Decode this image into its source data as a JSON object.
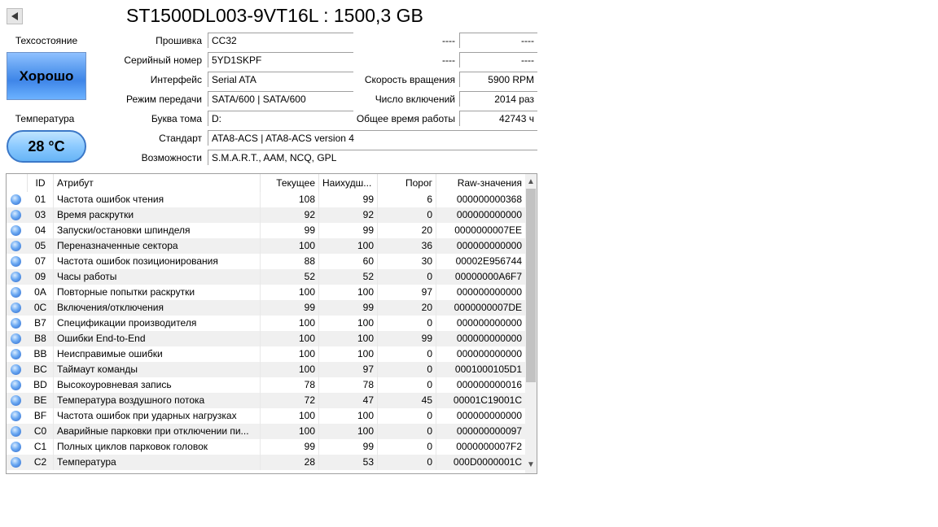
{
  "title": "ST1500DL003-9VT16L : 1500,3 GB",
  "status": {
    "health_label": "Техсостояние",
    "health_value": "Хорошо",
    "temp_label": "Температура",
    "temp_value": "28 °C",
    "health_color": "#4a8fe8"
  },
  "info": {
    "firmware_label": "Прошивка",
    "firmware": "CC32",
    "serial_label": "Серийный номер",
    "serial": "5YD1SKPF",
    "interface_label": "Интерфейс",
    "interface": "Serial ATA",
    "transfer_label": "Режим передачи",
    "transfer": "SATA/600 | SATA/600",
    "volume_label": "Буква тома",
    "volume": "D:",
    "standard_label": "Стандарт",
    "standard": "ATA8-ACS | ATA8-ACS version 4",
    "features_label": "Возможности",
    "features": "S.M.A.R.T., AAM, NCQ, GPL",
    "r1_label": "----",
    "r1_value": "----",
    "r2_label": "----",
    "r2_value": "----",
    "rpm_label": "Скорость вращения",
    "rpm": "5900 RPM",
    "power_count_label": "Число включений",
    "power_count": "2014 раз",
    "power_hours_label": "Общее время работы",
    "power_hours": "42743 ч"
  },
  "table": {
    "headers": [
      "ID",
      "Атрибут",
      "Текущее",
      "Наихудш...",
      "Порог",
      "Raw-значения"
    ],
    "rows": [
      {
        "id": "01",
        "name": "Частота ошибок чтения",
        "cur": "108",
        "worst": "99",
        "thr": "6",
        "raw": "000000000368"
      },
      {
        "id": "03",
        "name": "Время раскрутки",
        "cur": "92",
        "worst": "92",
        "thr": "0",
        "raw": "000000000000"
      },
      {
        "id": "04",
        "name": "Запуски/остановки шпинделя",
        "cur": "99",
        "worst": "99",
        "thr": "20",
        "raw": "0000000007EE"
      },
      {
        "id": "05",
        "name": "Переназначенные сектора",
        "cur": "100",
        "worst": "100",
        "thr": "36",
        "raw": "000000000000"
      },
      {
        "id": "07",
        "name": "Частота ошибок позиционирования",
        "cur": "88",
        "worst": "60",
        "thr": "30",
        "raw": "00002E956744"
      },
      {
        "id": "09",
        "name": "Часы работы",
        "cur": "52",
        "worst": "52",
        "thr": "0",
        "raw": "00000000A6F7"
      },
      {
        "id": "0A",
        "name": "Повторные попытки раскрутки",
        "cur": "100",
        "worst": "100",
        "thr": "97",
        "raw": "000000000000"
      },
      {
        "id": "0C",
        "name": "Включения/отключения",
        "cur": "99",
        "worst": "99",
        "thr": "20",
        "raw": "0000000007DE"
      },
      {
        "id": "B7",
        "name": "Спецификации производителя",
        "cur": "100",
        "worst": "100",
        "thr": "0",
        "raw": "000000000000"
      },
      {
        "id": "B8",
        "name": "Ошибки End-to-End",
        "cur": "100",
        "worst": "100",
        "thr": "99",
        "raw": "000000000000"
      },
      {
        "id": "BB",
        "name": "Неисправимые ошибки",
        "cur": "100",
        "worst": "100",
        "thr": "0",
        "raw": "000000000000"
      },
      {
        "id": "BC",
        "name": "Таймаут команды",
        "cur": "100",
        "worst": "97",
        "thr": "0",
        "raw": "0001000105D1"
      },
      {
        "id": "BD",
        "name": "Высокоуровневая запись",
        "cur": "78",
        "worst": "78",
        "thr": "0",
        "raw": "000000000016"
      },
      {
        "id": "BE",
        "name": "Температура воздушного потока",
        "cur": "72",
        "worst": "47",
        "thr": "45",
        "raw": "00001C19001C"
      },
      {
        "id": "BF",
        "name": "Частота ошибок при ударных нагрузках",
        "cur": "100",
        "worst": "100",
        "thr": "0",
        "raw": "000000000000"
      },
      {
        "id": "C0",
        "name": "Аварийные парковки при отключении пи...",
        "cur": "100",
        "worst": "100",
        "thr": "0",
        "raw": "000000000097"
      },
      {
        "id": "C1",
        "name": "Полных циклов парковок головок",
        "cur": "99",
        "worst": "99",
        "thr": "0",
        "raw": "0000000007F2"
      },
      {
        "id": "C2",
        "name": "Температура",
        "cur": "28",
        "worst": "53",
        "thr": "0",
        "raw": "000D0000001C"
      }
    ]
  }
}
